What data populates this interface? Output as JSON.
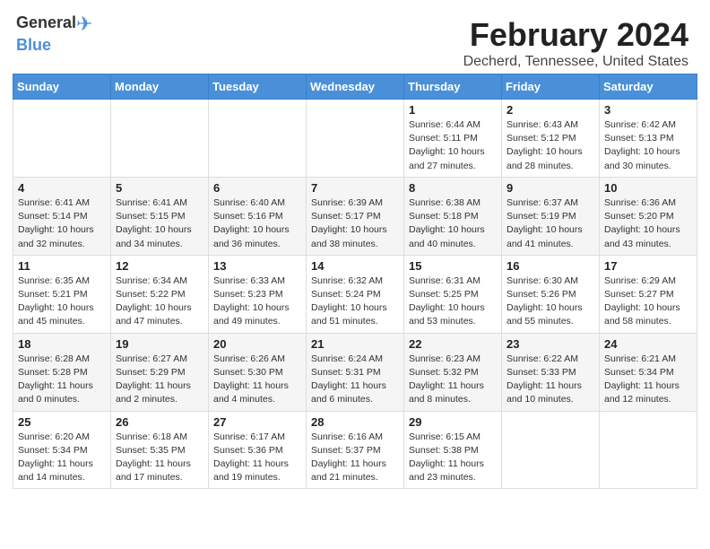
{
  "header": {
    "title": "February 2024",
    "subtitle": "Decherd, Tennessee, United States",
    "logo_general": "General",
    "logo_blue": "Blue"
  },
  "calendar": {
    "weekdays": [
      "Sunday",
      "Monday",
      "Tuesday",
      "Wednesday",
      "Thursday",
      "Friday",
      "Saturday"
    ],
    "weeks": [
      [
        {
          "day": "",
          "info": ""
        },
        {
          "day": "",
          "info": ""
        },
        {
          "day": "",
          "info": ""
        },
        {
          "day": "",
          "info": ""
        },
        {
          "day": "1",
          "info": "Sunrise: 6:44 AM\nSunset: 5:11 PM\nDaylight: 10 hours\nand 27 minutes."
        },
        {
          "day": "2",
          "info": "Sunrise: 6:43 AM\nSunset: 5:12 PM\nDaylight: 10 hours\nand 28 minutes."
        },
        {
          "day": "3",
          "info": "Sunrise: 6:42 AM\nSunset: 5:13 PM\nDaylight: 10 hours\nand 30 minutes."
        }
      ],
      [
        {
          "day": "4",
          "info": "Sunrise: 6:41 AM\nSunset: 5:14 PM\nDaylight: 10 hours\nand 32 minutes."
        },
        {
          "day": "5",
          "info": "Sunrise: 6:41 AM\nSunset: 5:15 PM\nDaylight: 10 hours\nand 34 minutes."
        },
        {
          "day": "6",
          "info": "Sunrise: 6:40 AM\nSunset: 5:16 PM\nDaylight: 10 hours\nand 36 minutes."
        },
        {
          "day": "7",
          "info": "Sunrise: 6:39 AM\nSunset: 5:17 PM\nDaylight: 10 hours\nand 38 minutes."
        },
        {
          "day": "8",
          "info": "Sunrise: 6:38 AM\nSunset: 5:18 PM\nDaylight: 10 hours\nand 40 minutes."
        },
        {
          "day": "9",
          "info": "Sunrise: 6:37 AM\nSunset: 5:19 PM\nDaylight: 10 hours\nand 41 minutes."
        },
        {
          "day": "10",
          "info": "Sunrise: 6:36 AM\nSunset: 5:20 PM\nDaylight: 10 hours\nand 43 minutes."
        }
      ],
      [
        {
          "day": "11",
          "info": "Sunrise: 6:35 AM\nSunset: 5:21 PM\nDaylight: 10 hours\nand 45 minutes."
        },
        {
          "day": "12",
          "info": "Sunrise: 6:34 AM\nSunset: 5:22 PM\nDaylight: 10 hours\nand 47 minutes."
        },
        {
          "day": "13",
          "info": "Sunrise: 6:33 AM\nSunset: 5:23 PM\nDaylight: 10 hours\nand 49 minutes."
        },
        {
          "day": "14",
          "info": "Sunrise: 6:32 AM\nSunset: 5:24 PM\nDaylight: 10 hours\nand 51 minutes."
        },
        {
          "day": "15",
          "info": "Sunrise: 6:31 AM\nSunset: 5:25 PM\nDaylight: 10 hours\nand 53 minutes."
        },
        {
          "day": "16",
          "info": "Sunrise: 6:30 AM\nSunset: 5:26 PM\nDaylight: 10 hours\nand 55 minutes."
        },
        {
          "day": "17",
          "info": "Sunrise: 6:29 AM\nSunset: 5:27 PM\nDaylight: 10 hours\nand 58 minutes."
        }
      ],
      [
        {
          "day": "18",
          "info": "Sunrise: 6:28 AM\nSunset: 5:28 PM\nDaylight: 11 hours\nand 0 minutes."
        },
        {
          "day": "19",
          "info": "Sunrise: 6:27 AM\nSunset: 5:29 PM\nDaylight: 11 hours\nand 2 minutes."
        },
        {
          "day": "20",
          "info": "Sunrise: 6:26 AM\nSunset: 5:30 PM\nDaylight: 11 hours\nand 4 minutes."
        },
        {
          "day": "21",
          "info": "Sunrise: 6:24 AM\nSunset: 5:31 PM\nDaylight: 11 hours\nand 6 minutes."
        },
        {
          "day": "22",
          "info": "Sunrise: 6:23 AM\nSunset: 5:32 PM\nDaylight: 11 hours\nand 8 minutes."
        },
        {
          "day": "23",
          "info": "Sunrise: 6:22 AM\nSunset: 5:33 PM\nDaylight: 11 hours\nand 10 minutes."
        },
        {
          "day": "24",
          "info": "Sunrise: 6:21 AM\nSunset: 5:34 PM\nDaylight: 11 hours\nand 12 minutes."
        }
      ],
      [
        {
          "day": "25",
          "info": "Sunrise: 6:20 AM\nSunset: 5:34 PM\nDaylight: 11 hours\nand 14 minutes."
        },
        {
          "day": "26",
          "info": "Sunrise: 6:18 AM\nSunset: 5:35 PM\nDaylight: 11 hours\nand 17 minutes."
        },
        {
          "day": "27",
          "info": "Sunrise: 6:17 AM\nSunset: 5:36 PM\nDaylight: 11 hours\nand 19 minutes."
        },
        {
          "day": "28",
          "info": "Sunrise: 6:16 AM\nSunset: 5:37 PM\nDaylight: 11 hours\nand 21 minutes."
        },
        {
          "day": "29",
          "info": "Sunrise: 6:15 AM\nSunset: 5:38 PM\nDaylight: 11 hours\nand 23 minutes."
        },
        {
          "day": "",
          "info": ""
        },
        {
          "day": "",
          "info": ""
        }
      ]
    ]
  }
}
